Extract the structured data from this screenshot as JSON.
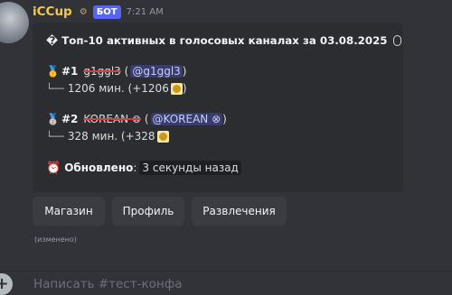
{
  "message": {
    "username": "iCCup",
    "role_icon": "role-icon",
    "bot_badge": "БОТ",
    "timestamp": "7:21 AM",
    "embed": {
      "title": "� Топ-10 активных в голосовых каналах за 03.08.2025",
      "entries": [
        {
          "medal": "🥇",
          "rank": "#1",
          "name": "g1ggl3",
          "mention": "@g1ggl3",
          "tree": "└──",
          "minutes_text": "1206 мин. (+1206"
        },
        {
          "medal": "🥈",
          "rank": "#2",
          "name": "KOREAN ⊗",
          "mention": "@KOREAN ⊗",
          "tree": "└──",
          "minutes_text": "328 мин. (+328"
        }
      ],
      "updated_label": "Обновлено",
      "updated_value": "3 секунды назад"
    },
    "buttons": [
      "Магазин",
      "Профиль",
      "Развлечения"
    ],
    "edited_note": "(изменено)"
  },
  "composer": {
    "placeholder": "Написать #тест-конфа"
  },
  "colors": {
    "background": "#323339",
    "embed": "#2b2d31",
    "username": "#f2c94c",
    "bot_badge": "#5865f2",
    "mention": "#c9cdfb",
    "strike": "#e03b3b"
  }
}
